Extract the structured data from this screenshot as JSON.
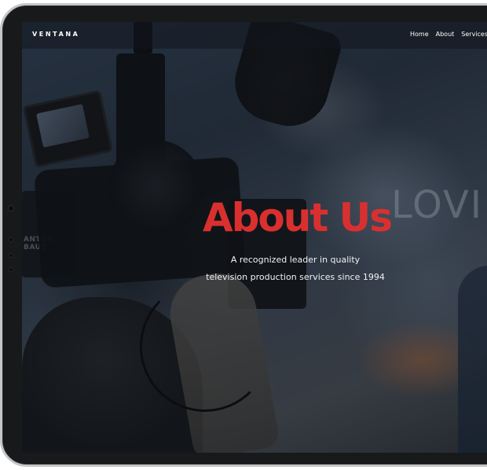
{
  "brand": {
    "name": "VENTANA"
  },
  "nav": {
    "links": [
      {
        "label": "Home"
      },
      {
        "label": "About"
      },
      {
        "label": "Services"
      }
    ]
  },
  "hero": {
    "title": "About Us",
    "subtitle_line1": "A recognized leader in quality",
    "subtitle_line2": "television production services since 1994",
    "background_photo": {
      "left_box_text": "ANTON\nBAUE",
      "sign_text": "LOVI"
    }
  },
  "colors": {
    "title": "#d9302f",
    "frame": "#18191b",
    "bezel": "#c4c6c9",
    "text": "#ffffff"
  }
}
